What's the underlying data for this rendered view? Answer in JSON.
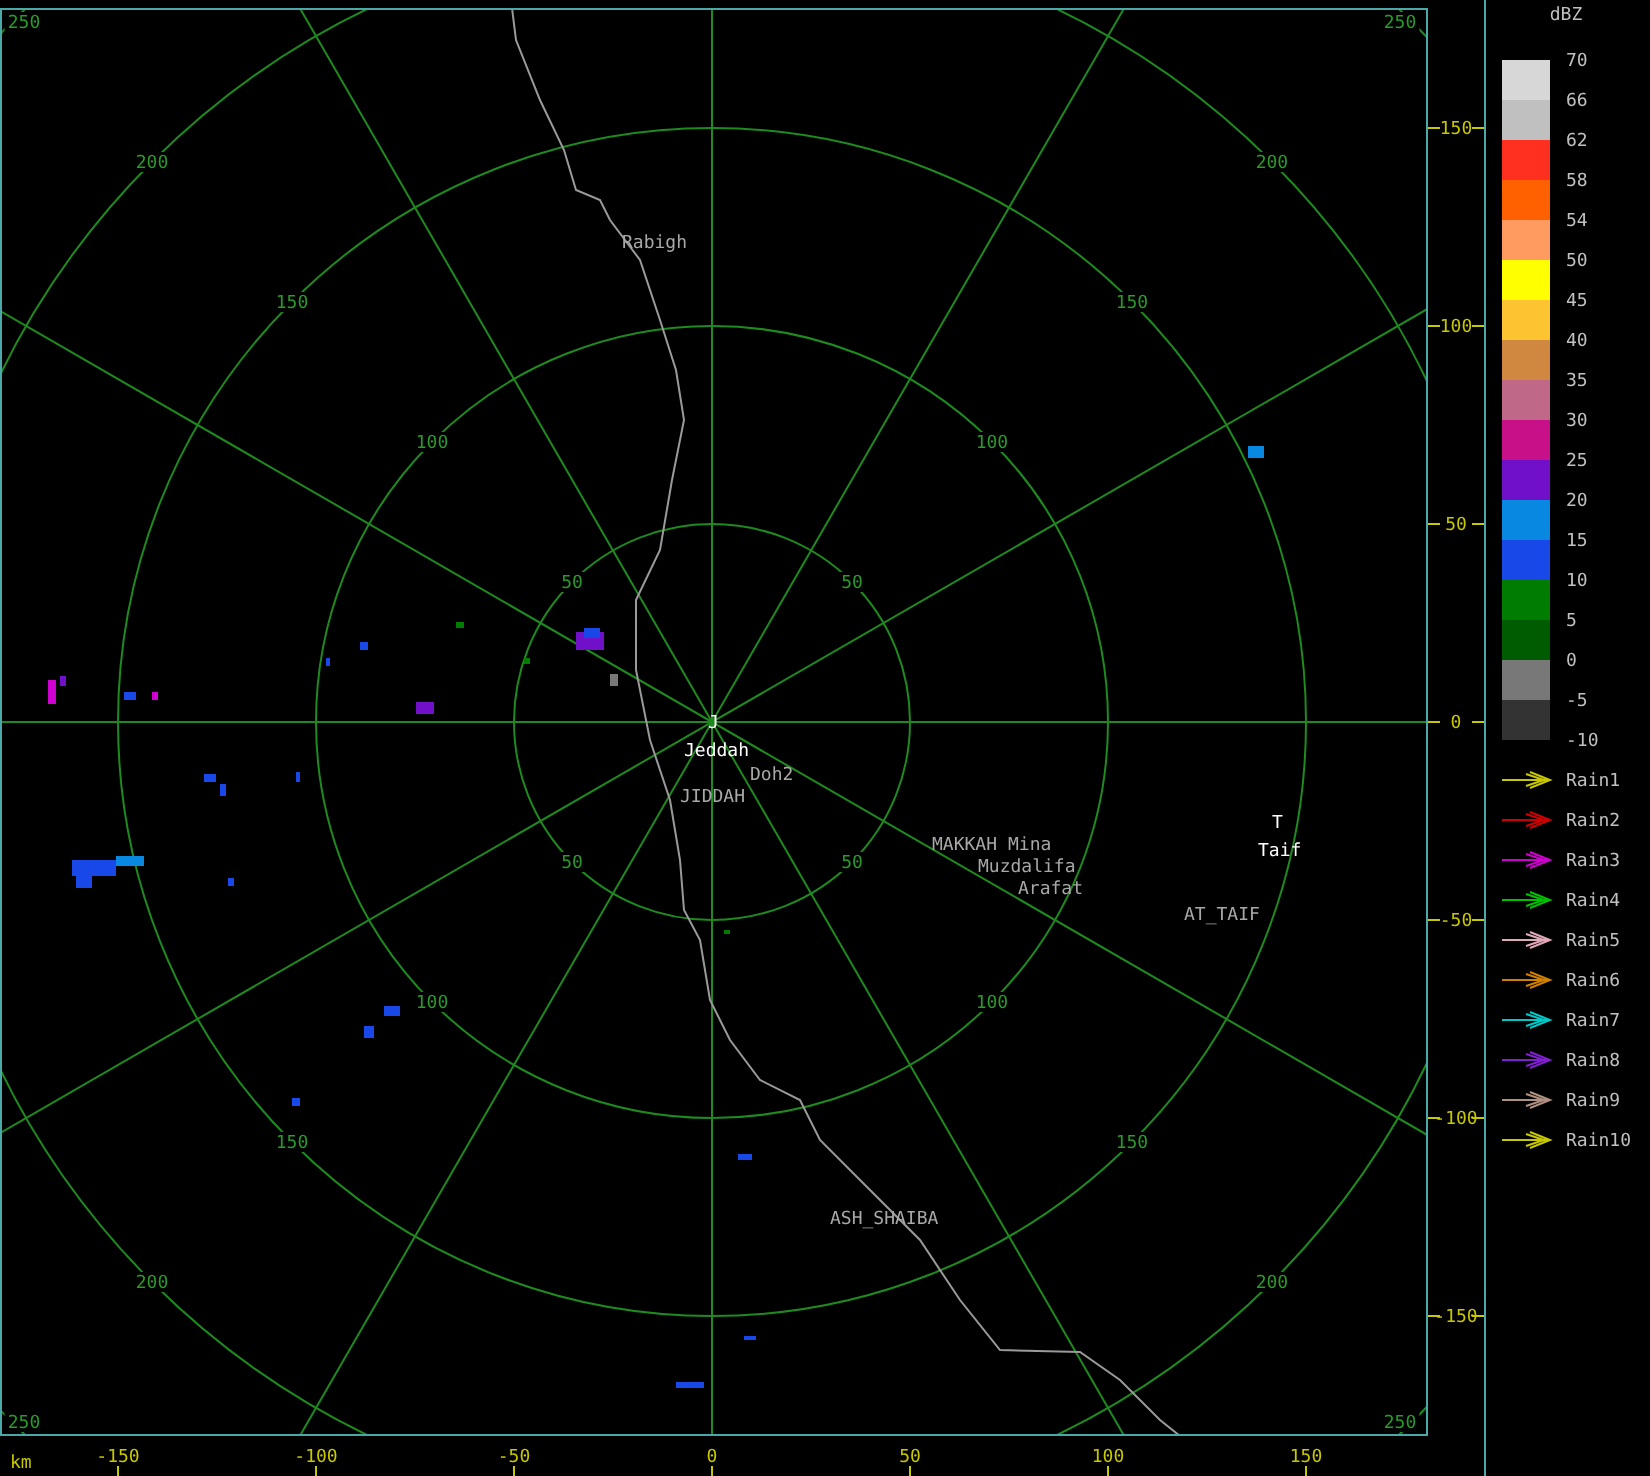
{
  "scope": {
    "range_rings": [
      {
        "labels": [
          "50",
          "50",
          "50",
          "50"
        ]
      },
      {
        "labels": [
          "100",
          "100",
          "100",
          "100"
        ]
      },
      {
        "labels": [
          "150",
          "150",
          "150",
          "150"
        ]
      },
      {
        "labels": [
          "200",
          "200",
          "200",
          "200"
        ]
      },
      {
        "labels": [
          "250",
          "250",
          "250",
          "250"
        ]
      }
    ],
    "places": [
      {
        "name": "Rabigh",
        "kind": "place"
      },
      {
        "name": "J",
        "kind": "station"
      },
      {
        "name": "Jeddah",
        "kind": "station"
      },
      {
        "name": "Doh2",
        "kind": "place"
      },
      {
        "name": "JIDDAH",
        "kind": "place"
      },
      {
        "name": "MAKKAH",
        "kind": "place"
      },
      {
        "name": "Mina",
        "kind": "place"
      },
      {
        "name": "Muzdalifa",
        "kind": "place"
      },
      {
        "name": "Arafat",
        "kind": "place"
      },
      {
        "name": "T",
        "kind": "station"
      },
      {
        "name": "Taif",
        "kind": "station"
      },
      {
        "name": "AT_TAIF",
        "kind": "place"
      },
      {
        "name": "ASH_SHAIBA",
        "kind": "place"
      }
    ],
    "x_axis": {
      "unit": "km",
      "ticks": [
        "-150",
        "-100",
        "-50",
        "0",
        "50",
        "100",
        "150"
      ]
    },
    "y_axis": {
      "ticks": [
        "150",
        "100",
        "50",
        "0",
        "-50",
        "-100",
        "-150"
      ]
    }
  },
  "legend": {
    "unit": "dBZ",
    "scale_labels": [
      "70",
      "66",
      "62",
      "58",
      "54",
      "50",
      "45",
      "40",
      "35",
      "30",
      "25",
      "20",
      "15",
      "10",
      "5",
      "0",
      "-5",
      "-10"
    ],
    "scale_colors": [
      {
        "color": "#d7d7d7"
      },
      {
        "color": "#c0c0c0"
      },
      {
        "color": "#ff3020"
      },
      {
        "color": "#ff6000"
      },
      {
        "color": "#ff9a60"
      },
      {
        "color": "#ffff00"
      },
      {
        "color": "#fbc430"
      },
      {
        "color": "#d08840"
      },
      {
        "color": "#c06888"
      },
      {
        "color": "#c81088"
      },
      {
        "color": "#7010c8"
      },
      {
        "color": "#0888e0"
      },
      {
        "color": "#1848e8"
      },
      {
        "color": "#007c00"
      },
      {
        "color": "#005c00"
      },
      {
        "color": "#787878"
      },
      {
        "color": "#333333"
      }
    ],
    "tracks": [
      {
        "label": "Rain1",
        "color": "#c8c800"
      },
      {
        "label": "Rain2",
        "color": "#d00000"
      },
      {
        "label": "Rain3",
        "color": "#d000d0"
      },
      {
        "label": "Rain4",
        "color": "#00c000"
      },
      {
        "label": "Rain5",
        "color": "#e0a8b8"
      },
      {
        "label": "Rain6",
        "color": "#d08000"
      },
      {
        "label": "Rain7",
        "color": "#00c8c8"
      },
      {
        "label": "Rain8",
        "color": "#8020d0"
      },
      {
        "label": "Rain9",
        "color": "#b09080"
      },
      {
        "label": "Rain10",
        "color": "#c8c800"
      }
    ]
  }
}
